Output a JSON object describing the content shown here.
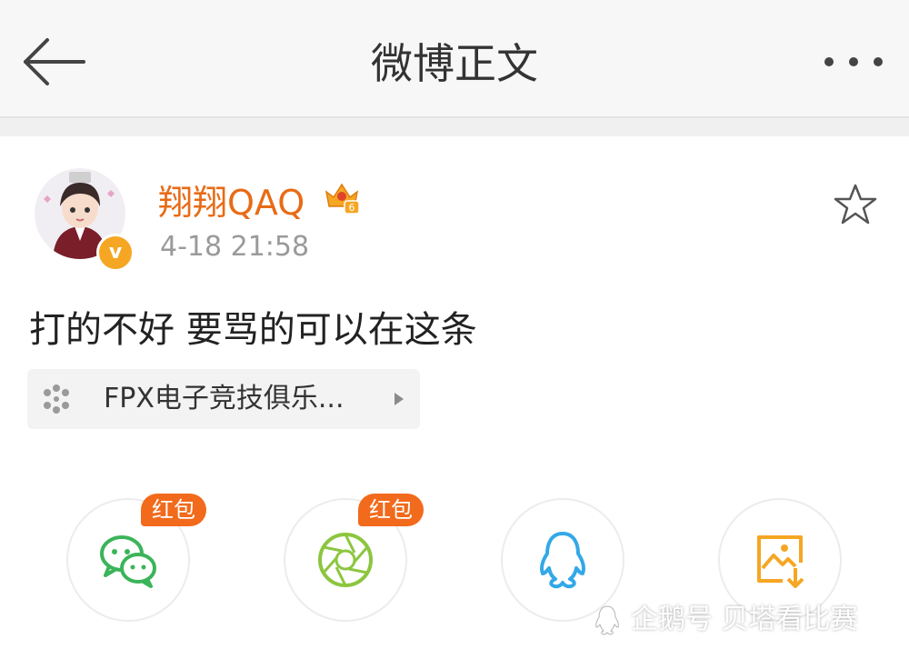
{
  "header": {
    "title": "微博正文"
  },
  "post": {
    "username": "翔翔QAQ",
    "vip_level": "6",
    "verified_mark": "v",
    "timestamp": "4-18 21:58",
    "text": "打的不好  要骂的可以在这条",
    "topic": {
      "label": "FPX电子竞技俱乐..."
    }
  },
  "share": {
    "wechat": {
      "badge": "红包"
    },
    "moments": {
      "badge": "红包"
    }
  },
  "watermark": {
    "text": "企鹅号 贝塔看比赛"
  },
  "colors": {
    "accent": "#e86b16",
    "badge_bg": "#f26a1b",
    "verified": "#f5a623"
  }
}
